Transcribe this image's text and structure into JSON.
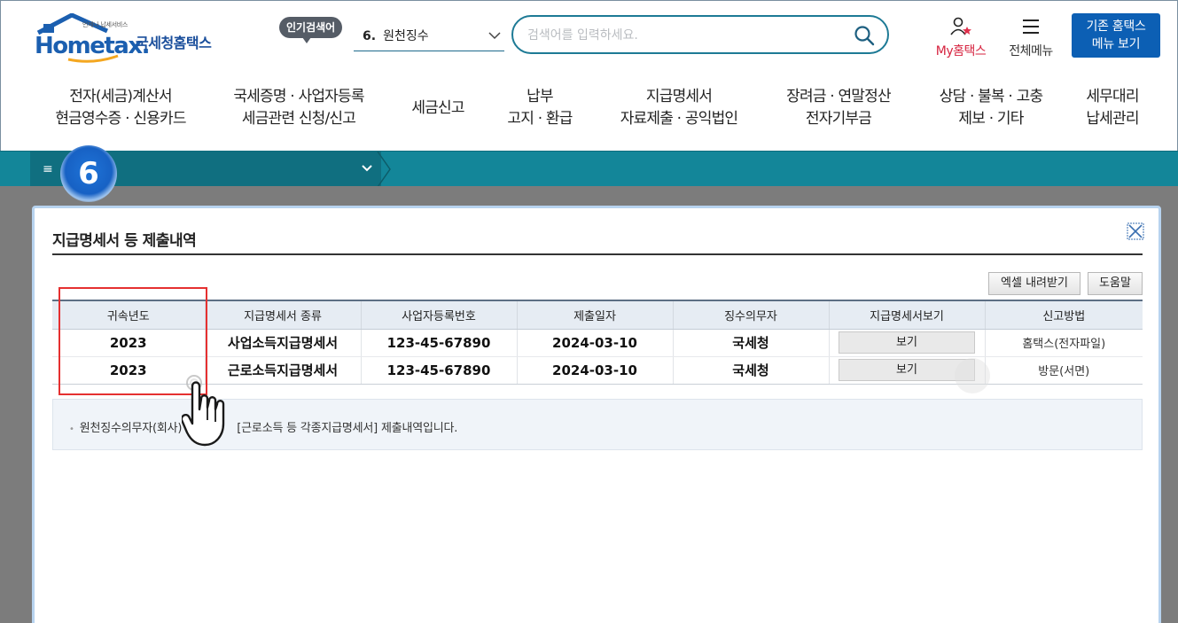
{
  "header": {
    "logo_tagline": "언제나 납세서비스",
    "logo_text": "Hometax.",
    "logo_korean": "국세청홈택스",
    "popular_badge": "인기검색어",
    "popular_item_num": "6.",
    "popular_item_label": "원천징수",
    "search_placeholder": "검색어를 입력하세요.",
    "my_hometax_label": "My홈택스",
    "all_menu_label": "전체메뉴",
    "legacy_line1": "기존 홈택스",
    "legacy_line2": "메뉴 보기"
  },
  "gnb": [
    {
      "line1": "전자(세금)계산서",
      "line2": "현금영수증 · 신용카드"
    },
    {
      "line1": "국세증명 · 사업자등록",
      "line2": "세금관련 신청/신고"
    },
    {
      "line1": "세금신고",
      "line2": ""
    },
    {
      "line1": "납부",
      "line2": "고지 · 환급"
    },
    {
      "line1": "지급명세서",
      "line2": "자료제출 · 공익법인"
    },
    {
      "line1": "장려금 · 연말정산",
      "line2": "전자기부금"
    },
    {
      "line1": "상담 · 불복 · 고충",
      "line2": "제보 · 기타"
    },
    {
      "line1": "세무대리",
      "line2": "납세관리"
    }
  ],
  "location": {
    "menu_glyph": "≡",
    "step_number": "6"
  },
  "modal": {
    "title": "지급명세서 등 제출내역",
    "excel_button": "엑셀 내려받기",
    "help_button": "도움말",
    "columns": [
      "귀속년도",
      "지급명세서 종류",
      "사업자등록번호",
      "제출일자",
      "징수의무자",
      "지급명세서보기",
      "신고방법"
    ],
    "rows": [
      {
        "year": "2023",
        "type": "사업소득지급명세서",
        "brn": "123-45-67890",
        "date": "2024-03-10",
        "payer": "국세청",
        "view": "보기",
        "method": "홈택스(전자파일)"
      },
      {
        "year": "2023",
        "type": "근로소득지급명세서",
        "brn": "123-45-67890",
        "date": "2024-03-10",
        "payer": "국세청",
        "view": "보기",
        "method": "방문(서면)"
      }
    ],
    "note_left": "원천징수의무자(회사)",
    "note_right": "[근로소득 등 각종지급명세서] 제출내역입니다."
  },
  "colors": {
    "brand_blue": "#0c5fb4",
    "teal_bar": "#138699",
    "highlight_red": "#e53030",
    "my_hometax_red": "#d6233f"
  },
  "icons": [
    "house-roof-icon",
    "chevron-down-icon",
    "search-icon",
    "user-star-icon",
    "hamburger-icon",
    "close-icon",
    "pointer-hand-icon"
  ]
}
